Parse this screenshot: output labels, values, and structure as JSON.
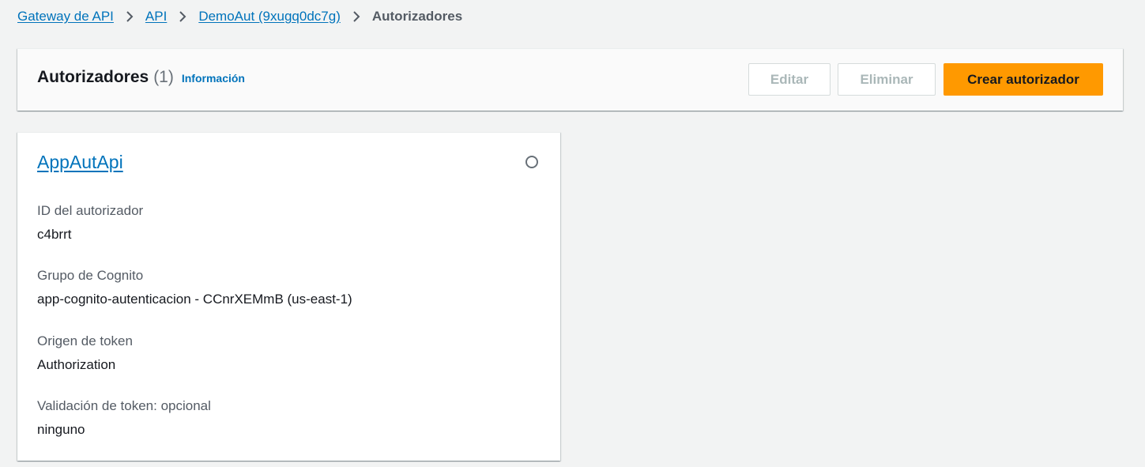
{
  "breadcrumb": {
    "items": [
      "Gateway de API",
      "API",
      "DemoAut (9xugq0dc7g)"
    ],
    "current": "Autorizadores"
  },
  "icons": {
    "breadcrumb_separator": "chevron-right-icon",
    "radio": "radio-button-unselected"
  },
  "header": {
    "title": "Autorizadores",
    "count": "(1)",
    "info_link": "Información",
    "buttons": {
      "edit": "Editar",
      "delete": "Eliminar",
      "create": "Crear autorizador"
    }
  },
  "authorizer": {
    "name": "AppAutApi",
    "fields": [
      {
        "label": "ID del autorizador",
        "value": "c4brrt"
      },
      {
        "label": "Grupo de Cognito",
        "value": "app-cognito-autenticacion - CCnrXEMmB (us-east-1)"
      },
      {
        "label": "Origen de token",
        "value": "Authorization"
      },
      {
        "label": "Validación de token: opcional",
        "value": "ninguno"
      }
    ]
  },
  "colors": {
    "link": "#0073bb",
    "primary_button": "#ff9900",
    "background": "#f2f3f3",
    "disabled_text": "#aab7b8"
  }
}
